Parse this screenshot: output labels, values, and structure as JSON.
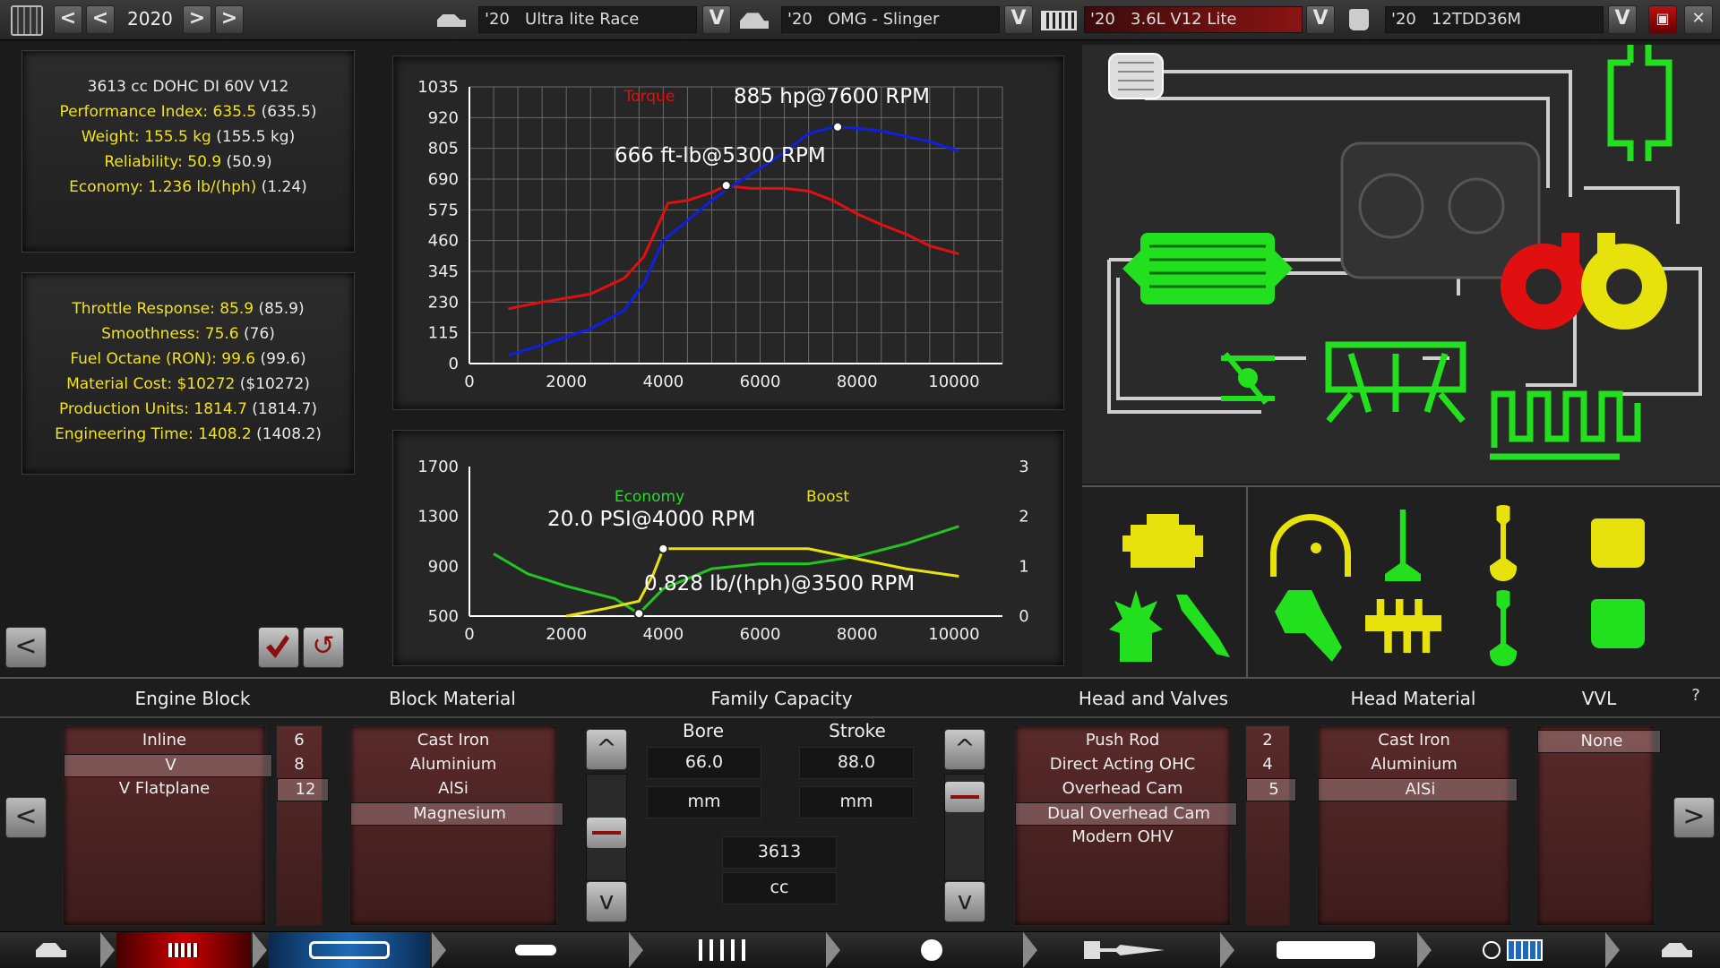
{
  "topbar": {
    "year": "2020",
    "car_model": "'20   Ultra lite Race",
    "trim": "'20   OMG - Slinger",
    "engine": "'20   3.6L V12 Lite",
    "variant": "'20   12TDD36M",
    "dropdown_label": "V",
    "prev_label": "<",
    "next_label": ">",
    "close_label": "✕"
  },
  "stats1": {
    "title": "3613 cc DOHC DI 60V V12",
    "rows": [
      {
        "k": "Performance Index: 635.5",
        "v": " (635.5)"
      },
      {
        "k": "Weight: 155.5 kg",
        "v": " (155.5 kg)"
      },
      {
        "k": "Reliability: 50.9",
        "v": " (50.9)"
      },
      {
        "k": "Economy: 1.236 lb/(hph)",
        "v": " (1.24)"
      }
    ]
  },
  "stats2": {
    "rows": [
      {
        "k": "Throttle Response: 85.9",
        "v": " (85.9)"
      },
      {
        "k": "Smoothness: 75.6",
        "v": " (76)"
      },
      {
        "k": "Fuel Octane (RON): 99.6",
        "v": " (99.6)"
      },
      {
        "k": "Material Cost: $10272",
        "v": " ($10272)"
      },
      {
        "k": "Production Units: 1814.7",
        "v": " (1814.7)"
      },
      {
        "k": "Engineering Time: 1408.2",
        "v": " (1408.2)"
      }
    ]
  },
  "chart_data": [
    {
      "type": "line",
      "series": [
        {
          "name": "Torque",
          "color": "#e01010",
          "x": [
            800,
            1500,
            2500,
            3200,
            3600,
            3900,
            4100,
            4500,
            5000,
            5300,
            5800,
            6500,
            7000,
            7500,
            8000,
            8500,
            9000,
            9500,
            10100
          ],
          "y": [
            205,
            230,
            260,
            320,
            400,
            520,
            600,
            610,
            640,
            666,
            655,
            655,
            645,
            610,
            560,
            520,
            485,
            440,
            410
          ]
        },
        {
          "name": "Power",
          "color": "#1020e0",
          "x": [
            800,
            1500,
            2500,
            3200,
            3600,
            4000,
            4400,
            5000,
            5300,
            6000,
            6500,
            7000,
            7400,
            7600,
            8000,
            8500,
            9000,
            9500,
            10100
          ],
          "y": [
            30,
            70,
            130,
            200,
            300,
            460,
            520,
            610,
            650,
            730,
            790,
            860,
            880,
            885,
            880,
            870,
            850,
            830,
            795
          ]
        }
      ],
      "legend": [
        "Torque"
      ],
      "annotations": [
        "885 hp@7600 RPM",
        "666 ft-lb@5300 RPM"
      ],
      "yticks": [
        "0",
        "115",
        "230",
        "345",
        "460",
        "575",
        "690",
        "805",
        "920",
        "1035"
      ],
      "xticks": [
        "0",
        "2000",
        "4000",
        "6000",
        "8000",
        "10000"
      ],
      "xlim": [
        0,
        11000
      ],
      "ylim": [
        0,
        1035
      ],
      "grid": true
    },
    {
      "type": "line",
      "series": [
        {
          "name": "Economy",
          "color": "#22c41e",
          "x": [
            500,
            1200,
            2000,
            3000,
            3500,
            4000,
            5000,
            6000,
            7000,
            8000,
            9000,
            10100
          ],
          "y": [
            1.25,
            0.85,
            0.6,
            0.35,
            0.05,
            0.55,
            0.95,
            1.05,
            1.05,
            1.2,
            1.45,
            1.8
          ]
        },
        {
          "name": "Boost",
          "color": "#e8e20c",
          "x": [
            2000,
            2800,
            3500,
            3800,
            4000,
            5000,
            6000,
            7000,
            8000,
            9000,
            10100
          ],
          "y": [
            0,
            0.15,
            0.3,
            0.85,
            1.35,
            1.35,
            1.35,
            1.35,
            1.15,
            0.95,
            0.8
          ]
        }
      ],
      "legend": [
        "Economy",
        "Boost"
      ],
      "annotations": [
        "20.0 PSI@4000 RPM",
        "0.828 lb/(hph)@3500 RPM"
      ],
      "yticks_left": [
        "500",
        "900",
        "1300",
        "1700"
      ],
      "yticks_right": [
        "0",
        "1",
        "2",
        "3"
      ],
      "xticks": [
        "0",
        "2000",
        "4000",
        "6000",
        "8000",
        "10000"
      ],
      "xlim": [
        0,
        11000
      ],
      "ylim": [
        0,
        3
      ],
      "grid": false
    }
  ],
  "bottom": {
    "engine_block": {
      "title": "Engine Block",
      "items": [
        "Inline",
        "V",
        "V Flatplane"
      ],
      "selected": 1,
      "counts": [
        "6",
        "8",
        "12"
      ],
      "count_selected": 2
    },
    "block_material": {
      "title": "Block Material",
      "items": [
        "Cast Iron",
        "Aluminium",
        "AlSi",
        "Magnesium"
      ],
      "selected": 3
    },
    "family_capacity": {
      "title": "Family Capacity",
      "bore_label": "Bore",
      "stroke_label": "Stroke",
      "bore": "66.0",
      "stroke": "88.0",
      "unit": "mm",
      "capacity": "3613",
      "capacity_unit": "cc",
      "up": "^",
      "down": "v"
    },
    "head_valves": {
      "title": "Head and Valves",
      "items": [
        "Push Rod",
        "Direct Acting OHC",
        "Overhead Cam",
        "Dual Overhead Cam",
        "Modern OHV"
      ],
      "selected": 3,
      "counts": [
        "2",
        "4",
        "5"
      ],
      "count_selected": 2
    },
    "head_material": {
      "title": "Head Material",
      "items": [
        "Cast Iron",
        "Aluminium",
        "AlSi"
      ],
      "selected": 2
    },
    "vvl": {
      "title": "VVL",
      "items": [
        "None"
      ],
      "selected": 0
    },
    "help": "?",
    "left_arrow": "<",
    "right_arrow": ">"
  },
  "colors": {
    "accent": "#f2e21c",
    "green": "#22e01e",
    "red": "#e01010",
    "yellow": "#e8e20c"
  }
}
